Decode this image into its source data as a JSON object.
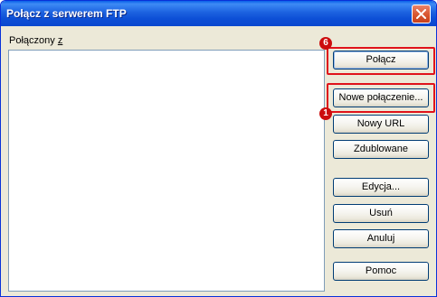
{
  "window": {
    "title": "Połącz z serwerem FTP",
    "close_icon": "close-icon"
  },
  "list": {
    "label_prefix": "Połączony ",
    "label_hotkey": "z",
    "items": []
  },
  "buttons": {
    "connect": "Połącz",
    "new_connection": "Nowe połączenie...",
    "new_url": "Nowy URL",
    "duplicate": "Zdublowane",
    "edit": "Edycja...",
    "delete": "Usuń",
    "cancel": "Anuluj",
    "help": "Pomoc"
  },
  "annotations": {
    "badge_connect": "6",
    "badge_new_connection": "1",
    "highlight_color": "#e0131b"
  },
  "colors": {
    "titlebar": "#0a48cf",
    "dialog_bg": "#ece9d8",
    "close_button": "#d8562f"
  }
}
